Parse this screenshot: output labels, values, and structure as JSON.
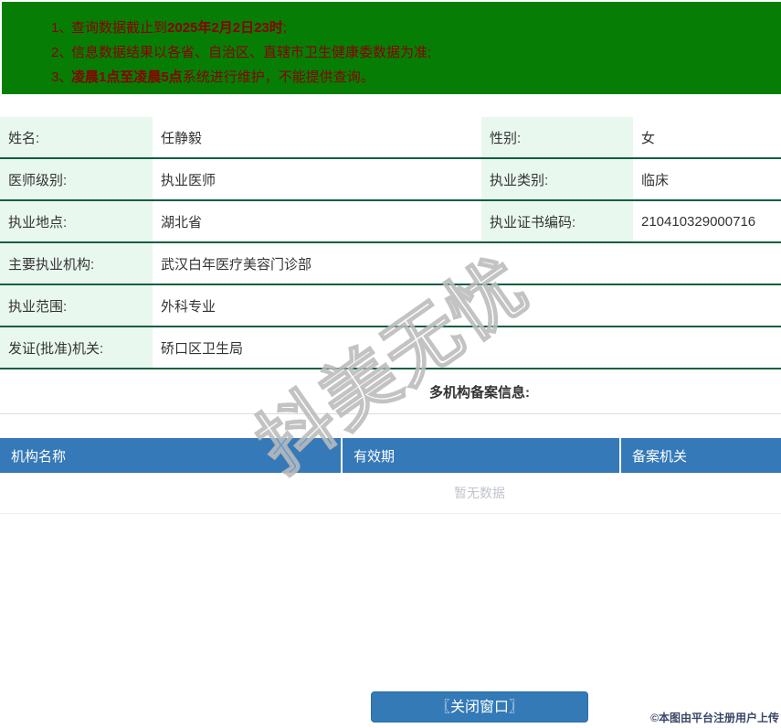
{
  "colors": {
    "banner_bg": "#067e06",
    "banner_text": "#8b0000",
    "row_border_green": "#0e5f3e",
    "label_cell_bg": "#e9f8ef",
    "table_header_bg": "#3579b8",
    "button_bg": "#337ab7",
    "empty_text": "#c0c4cc"
  },
  "notice": {
    "items": [
      {
        "num": "1、",
        "pre": "查询数据截止到",
        "bold": "2025年2月2日23时",
        "post": ";"
      },
      {
        "num": "2、",
        "pre": "信息数据结果以各省、自治区、直辖市卫生健康委数据为准;",
        "bold": "",
        "post": ""
      },
      {
        "num": "3、",
        "pre": "",
        "bold": "凌晨1点至凌晨5点",
        "post": "系统进行维护，不能提供查询。"
      }
    ]
  },
  "info": {
    "rows": [
      {
        "label": "姓名:",
        "value": "任静毅",
        "label2": "性别:",
        "value2": "女"
      },
      {
        "label": "医师级别:",
        "value": "执业医师",
        "label2": "执业类别:",
        "value2": "临床"
      },
      {
        "label": "执业地点:",
        "value": "湖北省",
        "label2": "执业证书编码:",
        "value2": "210410329000716"
      },
      {
        "label": "主要执业机构:",
        "value": "武汉白年医疗美容门诊部"
      },
      {
        "label": "执业范围:",
        "value": "外科专业"
      },
      {
        "label": "发证(批准)机关:",
        "value": "硚口区卫生局"
      }
    ]
  },
  "section": {
    "title": "多机构备案信息:"
  },
  "filing_table": {
    "headers": [
      "机构名称",
      "有效期",
      "备案机关"
    ],
    "empty_text": "暂无数据"
  },
  "footer": {
    "close_button_label": "〖关闭窗口〗"
  },
  "watermarks": {
    "diagonal_text": "抖美无忧",
    "uploader_text": "©本图由平台注册用户上传"
  }
}
